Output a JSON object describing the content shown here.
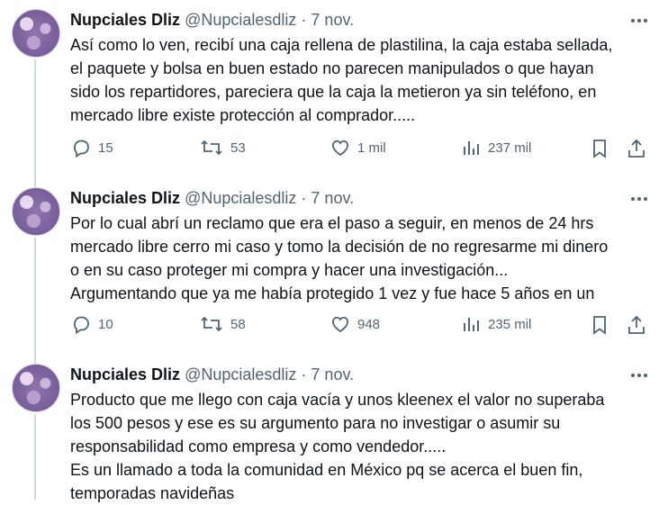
{
  "tweets": [
    {
      "author": "Nupciales Dliz",
      "handle": "@Nupcialesdliz",
      "sep": "·",
      "date": "7 nov.",
      "text": "Así como lo ven, recibí una caja rellena de plastilina, la caja estaba sellada,\nel paquete y bolsa en buen estado no parecen manipulados o que hayan\nsido los repartidores, pareciera que la caja la metieron ya sin teléfono, en\nmercado libre existe protección al comprador.....",
      "replies": "15",
      "retweets": "53",
      "likes": "1 mil",
      "views": "237 mil"
    },
    {
      "author": "Nupciales Dliz",
      "handle": "@Nupcialesdliz",
      "sep": "·",
      "date": "7 nov.",
      "text": "Por lo cual abrí un reclamo que era el paso a seguir, en menos de 24 hrs\nmercado libre cerro mi caso y tomo la decisión de no regresarme mi dinero\no en su caso proteger mi compra y hacer una investigación...\nArgumentando que ya me había protegido 1 vez y fue hace 5 años en un",
      "replies": "10",
      "retweets": "58",
      "likes": "948",
      "views": "235 mil"
    },
    {
      "author": "Nupciales Dliz",
      "handle": "@Nupcialesdliz",
      "sep": "·",
      "date": "7 nov.",
      "text": "Producto que me llego con caja vacía y unos kleenex el valor no superaba\nlos 500 pesos y ese es su argumento para no investigar o asumir su\nresponsabilidad como empresa y como vendedor.....\nEs un llamado a toda la comunidad en México pq se acerca el buen fin,\ntemporadas navideñas"
    }
  ],
  "icons": [
    "reply-icon",
    "retweet-icon",
    "like-icon",
    "views-icon",
    "bookmark-icon",
    "share-icon",
    "more-icon"
  ]
}
